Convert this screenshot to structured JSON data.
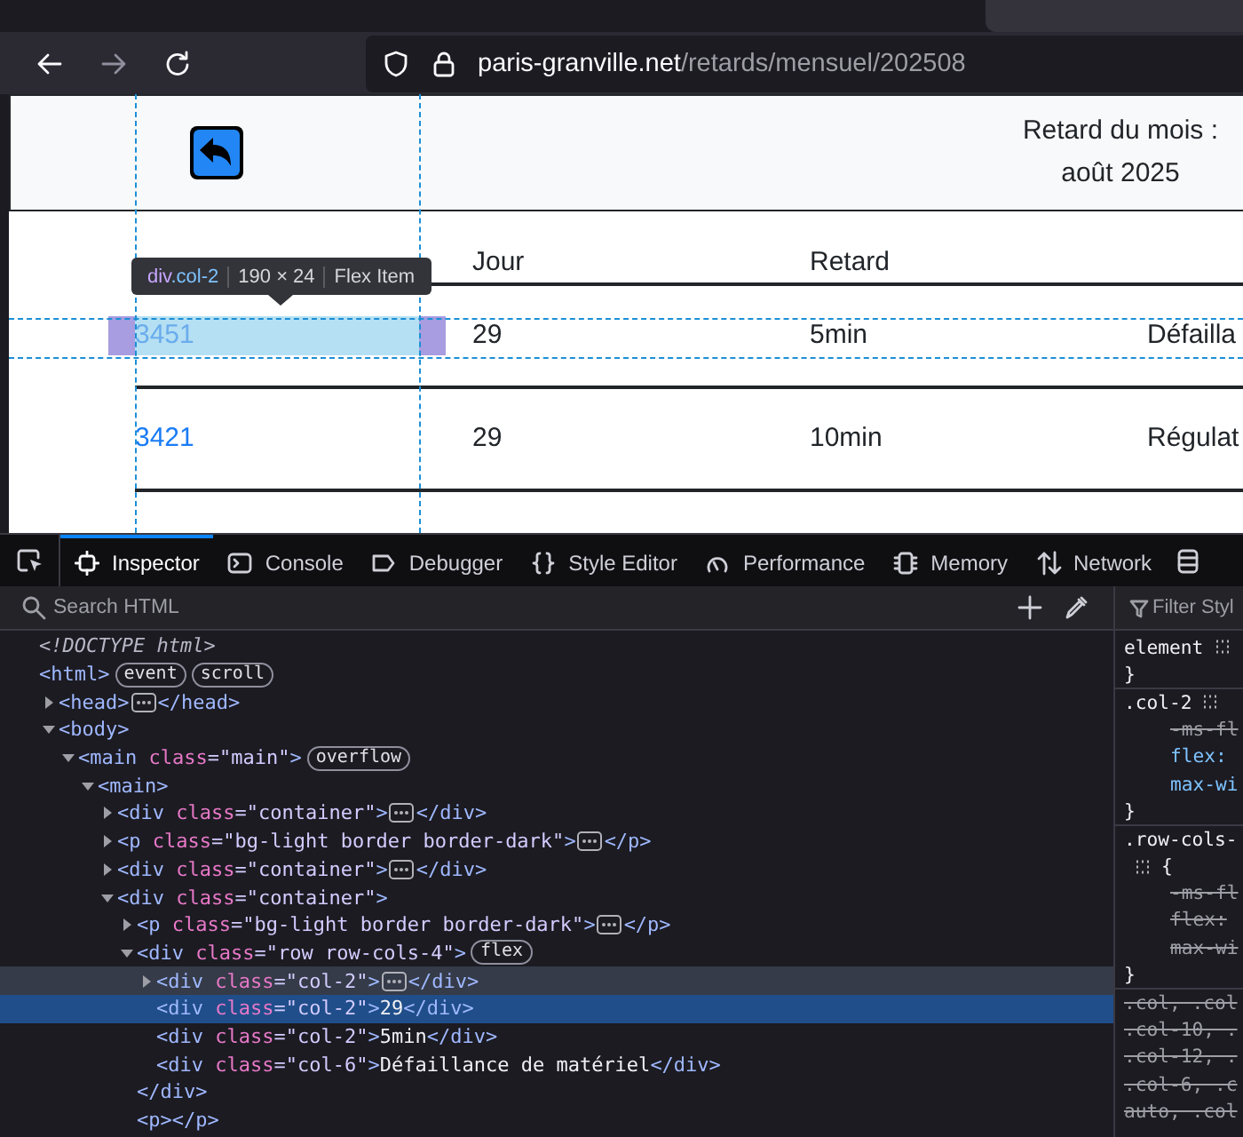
{
  "browser": {
    "nav_buttons": [
      {
        "kind": "back",
        "disabled": false
      },
      {
        "kind": "forward",
        "disabled": true
      },
      {
        "kind": "reload",
        "disabled": false
      }
    ],
    "address": {
      "host": "paris-granville.net",
      "path": "/retards/mensuel/202508"
    }
  },
  "page": {
    "header": {
      "title": "Retard du mois :",
      "month": "août 2025"
    },
    "table": {
      "column_headers": [
        "Jour",
        "Retard"
      ],
      "rows": [
        {
          "train": "3451",
          "day": "29",
          "delay": "5min",
          "column_4": "Défailla",
          "highlighted": true
        },
        {
          "train": "3421",
          "day": "29",
          "delay": "10min",
          "column_4": "Régulat",
          "highlighted": false
        }
      ]
    },
    "inspector_tooltip": {
      "tag": "div",
      "class_name": ".col-2",
      "size": "190 × 24",
      "layout": "Flex Item"
    }
  },
  "devtools": {
    "tabs": [
      {
        "label": "Inspector",
        "kind": "inspector",
        "selected": true
      },
      {
        "label": "Console",
        "kind": "console",
        "selected": false
      },
      {
        "label": "Debugger",
        "kind": "debugger",
        "selected": false
      },
      {
        "label": "Style Editor",
        "kind": "style-editor",
        "selected": false
      },
      {
        "label": "Performance",
        "kind": "performance",
        "selected": false
      },
      {
        "label": "Memory",
        "kind": "memory",
        "selected": false
      },
      {
        "label": "Network",
        "kind": "network",
        "selected": false
      }
    ],
    "search": {
      "placeholder": "Search HTML"
    },
    "markup": [
      {
        "tokens": [
          {
            "kind": "doctype",
            "text": "<!DOCTYPE html>"
          }
        ],
        "selected": false,
        "hovered": false
      },
      {
        "tokens": [
          {
            "kind": "tag",
            "text": "<html>"
          }
        ],
        "badges": [
          "event",
          "scroll"
        ],
        "selected": false,
        "hovered": false,
        "children": [
          {
            "tokens": [
              {
                "kind": "tag",
                "text": "<head>"
              },
              {
                "kind": "ellipsis"
              },
              {
                "kind": "tag",
                "text": "</head>"
              }
            ],
            "expanded": false,
            "selected": false,
            "hovered": false
          },
          {
            "tokens": [
              {
                "kind": "tag",
                "text": "<body>"
              }
            ],
            "expanded": true,
            "selected": false,
            "hovered": false,
            "children": [
              {
                "tokens": [
                  {
                    "kind": "tag",
                    "text": "<main"
                  },
                  {
                    "kind": "attr",
                    "text": " class"
                  },
                  {
                    "kind": "value",
                    "text": "=\"main\""
                  },
                  {
                    "kind": "tag",
                    "text": ">"
                  }
                ],
                "badges": [
                  "overflow"
                ],
                "expanded": true,
                "selected": false,
                "hovered": false,
                "children": [
                  {
                    "tokens": [
                      {
                        "kind": "tag",
                        "text": "<main>"
                      }
                    ],
                    "expanded": true,
                    "selected": false,
                    "hovered": false,
                    "children": [
                      {
                        "tokens": [
                          {
                            "kind": "tag",
                            "text": "<div"
                          },
                          {
                            "kind": "attr",
                            "text": " class"
                          },
                          {
                            "kind": "value",
                            "text": "=\"container\""
                          },
                          {
                            "kind": "tag",
                            "text": ">"
                          },
                          {
                            "kind": "ellipsis"
                          },
                          {
                            "kind": "tag",
                            "text": "</div>"
                          }
                        ],
                        "expanded": false,
                        "selected": false,
                        "hovered": false
                      },
                      {
                        "tokens": [
                          {
                            "kind": "tag",
                            "text": "<p"
                          },
                          {
                            "kind": "attr",
                            "text": " class"
                          },
                          {
                            "kind": "value",
                            "text": "=\"bg-light border border-dark\""
                          },
                          {
                            "kind": "tag",
                            "text": ">"
                          },
                          {
                            "kind": "ellipsis"
                          },
                          {
                            "kind": "tag",
                            "text": "</p>"
                          }
                        ],
                        "expanded": false,
                        "selected": false,
                        "hovered": false
                      },
                      {
                        "tokens": [
                          {
                            "kind": "tag",
                            "text": "<div"
                          },
                          {
                            "kind": "attr",
                            "text": " class"
                          },
                          {
                            "kind": "value",
                            "text": "=\"container\""
                          },
                          {
                            "kind": "tag",
                            "text": ">"
                          },
                          {
                            "kind": "ellipsis"
                          },
                          {
                            "kind": "tag",
                            "text": "</div>"
                          }
                        ],
                        "expanded": false,
                        "selected": false,
                        "hovered": false
                      },
                      {
                        "tokens": [
                          {
                            "kind": "tag",
                            "text": "<div"
                          },
                          {
                            "kind": "attr",
                            "text": " class"
                          },
                          {
                            "kind": "value",
                            "text": "=\"container\""
                          },
                          {
                            "kind": "tag",
                            "text": ">"
                          }
                        ],
                        "expanded": true,
                        "selected": false,
                        "hovered": false,
                        "children": [
                          {
                            "tokens": [
                              {
                                "kind": "tag",
                                "text": "<p"
                              },
                              {
                                "kind": "attr",
                                "text": " class"
                              },
                              {
                                "kind": "value",
                                "text": "=\"bg-light border border-dark\""
                              },
                              {
                                "kind": "tag",
                                "text": ">"
                              },
                              {
                                "kind": "ellipsis"
                              },
                              {
                                "kind": "tag",
                                "text": "</p>"
                              }
                            ],
                            "expanded": false,
                            "selected": false,
                            "hovered": false
                          },
                          {
                            "tokens": [
                              {
                                "kind": "tag",
                                "text": "<div"
                              },
                              {
                                "kind": "attr",
                                "text": " class"
                              },
                              {
                                "kind": "value",
                                "text": "=\"row row-cols-4\""
                              },
                              {
                                "kind": "tag",
                                "text": ">"
                              }
                            ],
                            "badges": [
                              "flex"
                            ],
                            "expanded": true,
                            "selected": false,
                            "hovered": false,
                            "close_tokens": [
                              {
                                "kind": "tag",
                                "text": "</div>"
                              }
                            ],
                            "children": [
                              {
                                "tokens": [
                                  {
                                    "kind": "tag",
                                    "text": "<div"
                                  },
                                  {
                                    "kind": "attr",
                                    "text": " class"
                                  },
                                  {
                                    "kind": "value",
                                    "text": "=\"col-2\""
                                  },
                                  {
                                    "kind": "tag",
                                    "text": ">"
                                  },
                                  {
                                    "kind": "ellipsis"
                                  },
                                  {
                                    "kind": "tag",
                                    "text": "</div>"
                                  }
                                ],
                                "expanded": false,
                                "selected": false,
                                "hovered": true
                              },
                              {
                                "tokens": [
                                  {
                                    "kind": "tag",
                                    "text": "<div"
                                  },
                                  {
                                    "kind": "attr",
                                    "text": " class"
                                  },
                                  {
                                    "kind": "value",
                                    "text": "=\"col-2\""
                                  },
                                  {
                                    "kind": "tag",
                                    "text": ">"
                                  },
                                  {
                                    "kind": "text",
                                    "text": "29"
                                  },
                                  {
                                    "kind": "tag",
                                    "text": "</div>"
                                  }
                                ],
                                "selected": true,
                                "hovered": false
                              },
                              {
                                "tokens": [
                                  {
                                    "kind": "tag",
                                    "text": "<div"
                                  },
                                  {
                                    "kind": "attr",
                                    "text": " class"
                                  },
                                  {
                                    "kind": "value",
                                    "text": "=\"col-2\""
                                  },
                                  {
                                    "kind": "tag",
                                    "text": ">"
                                  },
                                  {
                                    "kind": "text",
                                    "text": "5min"
                                  },
                                  {
                                    "kind": "tag",
                                    "text": "</div>"
                                  }
                                ],
                                "selected": false,
                                "hovered": false
                              },
                              {
                                "tokens": [
                                  {
                                    "kind": "tag",
                                    "text": "<div"
                                  },
                                  {
                                    "kind": "attr",
                                    "text": " class"
                                  },
                                  {
                                    "kind": "value",
                                    "text": "=\"col-6\""
                                  },
                                  {
                                    "kind": "tag",
                                    "text": ">"
                                  },
                                  {
                                    "kind": "text",
                                    "text": "Défaillance de matériel"
                                  },
                                  {
                                    "kind": "tag",
                                    "text": "</div>"
                                  }
                                ],
                                "selected": false,
                                "hovered": false
                              }
                            ]
                          },
                          {
                            "tokens": [
                              {
                                "kind": "tag",
                                "text": "<p></p>"
                              }
                            ],
                            "selected": false,
                            "hovered": false
                          }
                        ]
                      }
                    ]
                  }
                ]
              }
            ]
          }
        ]
      }
    ],
    "rules_filter": {
      "placeholder": "Filter Styl"
    },
    "rules": [
      {
        "kind": "selector",
        "text": "element",
        "grid_icon": true,
        "overridden": false
      },
      {
        "kind": "close",
        "text": "}"
      },
      {
        "kind": "selector",
        "text": ".col-2",
        "grid_icon": true,
        "overridden": false
      },
      {
        "kind": "declaration",
        "text": "-ms-fl",
        "overridden": true
      },
      {
        "kind": "declaration",
        "text": "flex:",
        "overridden": false
      },
      {
        "kind": "declaration",
        "text": "max-wi",
        "overridden": false
      },
      {
        "kind": "close",
        "text": "}"
      },
      {
        "kind": "selector",
        "text": ".row-cols-",
        "overridden": false
      },
      {
        "kind": "open",
        "text": "{",
        "grid_icon": true
      },
      {
        "kind": "declaration",
        "text": "-ms-fl",
        "overridden": true
      },
      {
        "kind": "declaration",
        "text": "flex:",
        "overridden": true
      },
      {
        "kind": "declaration",
        "text": "max-wi",
        "overridden": true
      },
      {
        "kind": "close",
        "text": "}"
      },
      {
        "kind": "selector",
        "text": ".col, .col",
        "overridden": true
      },
      {
        "kind": "selector",
        "text": ".col-10, .",
        "overridden": true
      },
      {
        "kind": "selector",
        "text": ".col-12, .",
        "overridden": true
      },
      {
        "kind": "selector",
        "text": ".col-6, .c",
        "overridden": true
      },
      {
        "kind": "selector",
        "text": "auto, .col",
        "overridden": true
      }
    ]
  }
}
